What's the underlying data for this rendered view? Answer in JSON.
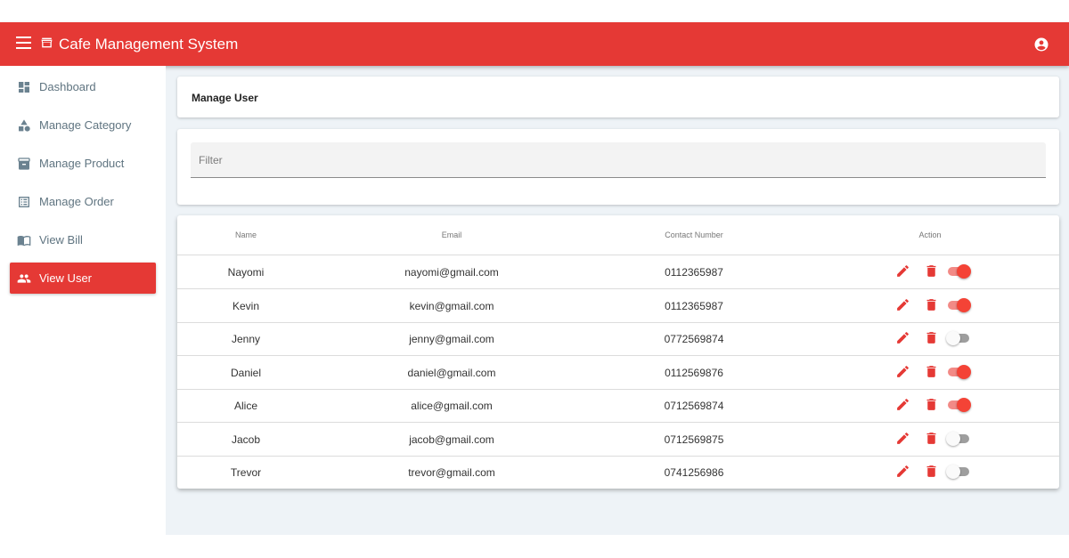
{
  "header": {
    "title": "Cafe Management System"
  },
  "sidebar": {
    "items": [
      {
        "label": "Dashboard",
        "icon": "dashboard-icon",
        "active": false
      },
      {
        "label": "Manage Category",
        "icon": "category-icon",
        "active": false
      },
      {
        "label": "Manage Product",
        "icon": "inventory-icon",
        "active": false
      },
      {
        "label": "Manage Order",
        "icon": "list-alt-icon",
        "active": false
      },
      {
        "label": "View Bill",
        "icon": "import-contacts-icon",
        "active": false
      },
      {
        "label": "View User",
        "icon": "people-icon",
        "active": true
      }
    ]
  },
  "main": {
    "title": "Manage User",
    "filter": {
      "placeholder": "Filter",
      "value": ""
    },
    "table": {
      "columns": [
        "Name",
        "Email",
        "Contact Number",
        "Action"
      ],
      "rows": [
        {
          "name": "Nayomi",
          "email": "nayomi@gmail.com",
          "contact": "0112365987",
          "enabled": true
        },
        {
          "name": "Kevin",
          "email": "kevin@gmail.com",
          "contact": "0112365987",
          "enabled": true
        },
        {
          "name": "Jenny",
          "email": "jenny@gmail.com",
          "contact": "0772569874",
          "enabled": false
        },
        {
          "name": "Daniel",
          "email": "daniel@gmail.com",
          "contact": "0112569876",
          "enabled": true
        },
        {
          "name": "Alice",
          "email": "alice@gmail.com",
          "contact": "0712569874",
          "enabled": true
        },
        {
          "name": "Jacob",
          "email": "jacob@gmail.com",
          "contact": "0712569875",
          "enabled": false
        },
        {
          "name": "Trevor",
          "email": "trevor@gmail.com",
          "contact": "0741256986",
          "enabled": false
        }
      ]
    }
  },
  "colors": {
    "primary": "#e53935",
    "toggle_on": "#f44336",
    "background": "#eef3f7"
  }
}
